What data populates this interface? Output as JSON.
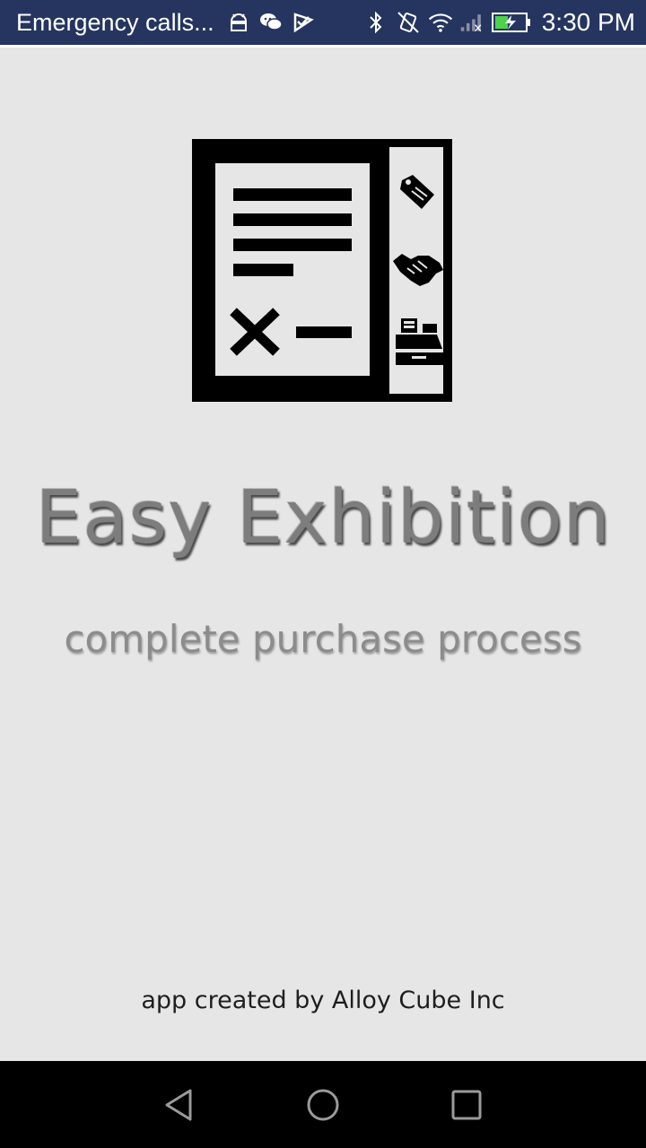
{
  "status_bar": {
    "notification_text": "Emergency calls...",
    "notification_icons": [
      "android-icon",
      "wechat-icon",
      "check-flag-icon"
    ],
    "system_icons": [
      "bluetooth-icon",
      "vibrate-icon",
      "wifi-icon",
      "cell-signal-icon",
      "battery-charging-icon"
    ],
    "clock": "3:30 PM",
    "background_color": "#26355f"
  },
  "splash": {
    "logo_icon": "exhibition-invoice-logo",
    "logo_side_icons": [
      "price-tag-icon",
      "handshake-icon",
      "cash-register-icon"
    ],
    "title": "Easy Exhibition",
    "subtitle": "complete purchase process",
    "credit": "app created by Alloy Cube Inc",
    "background_color": "#e6e6e6"
  },
  "nav_bar": {
    "buttons": [
      "back-icon",
      "home-icon",
      "recents-icon"
    ]
  }
}
